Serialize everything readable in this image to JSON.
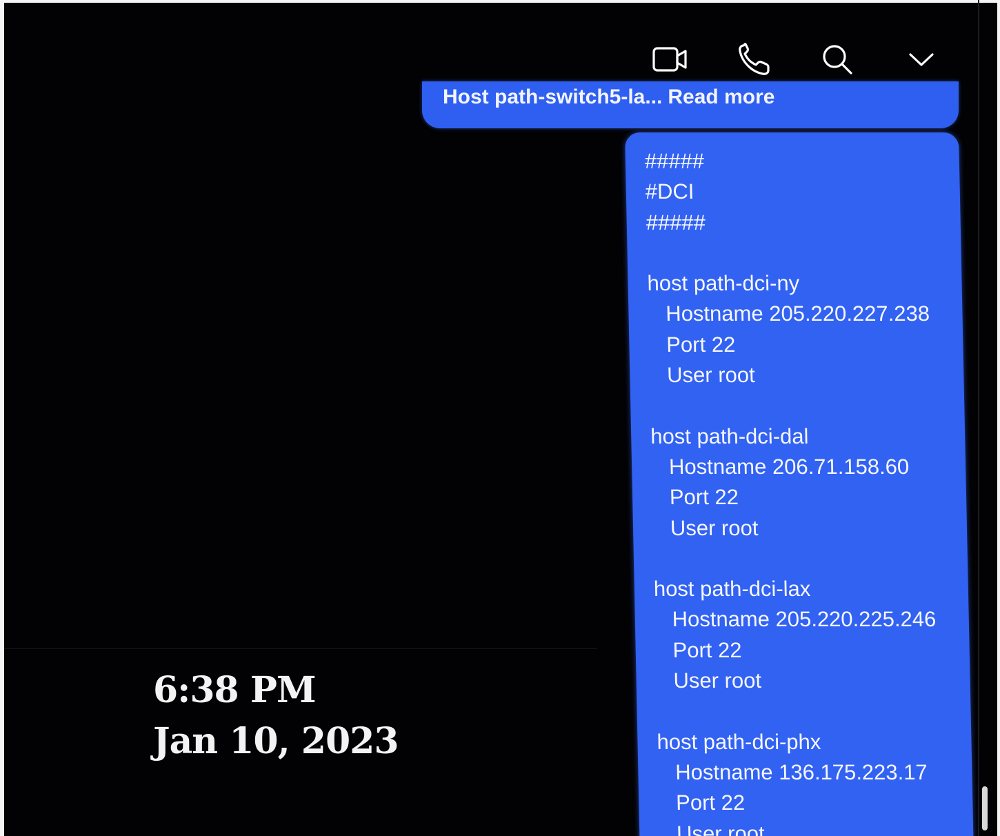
{
  "chat": {
    "toolbar": {
      "video_icon": "video-camera-icon",
      "call_icon": "phone-icon",
      "search_icon": "search-icon",
      "menu_icon": "chevron-down-icon"
    },
    "previous_message": {
      "text": "Host path-switch5-la...",
      "read_more": "Read more"
    },
    "message": {
      "lines": [
        "#####",
        "#DCI",
        "#####",
        "",
        "host path-dci-ny",
        "   Hostname 205.220.227.238",
        "   Port 22",
        "   User root",
        "",
        "host path-dci-dal",
        "   Hostname 206.71.158.60",
        "   Port 22",
        "   User root",
        "",
        "host path-dci-lax",
        "   Hostname 205.220.225.246",
        "   Port 22",
        "   User root",
        "",
        "host path-dci-phx",
        "   Hostname 136.175.223.17",
        "   Port 22",
        "   User root"
      ]
    }
  },
  "overlay": {
    "time": "6:38 PM",
    "date": "Jan 10, 2023"
  },
  "colors": {
    "bubble": "#3262f2",
    "background": "#020204"
  }
}
